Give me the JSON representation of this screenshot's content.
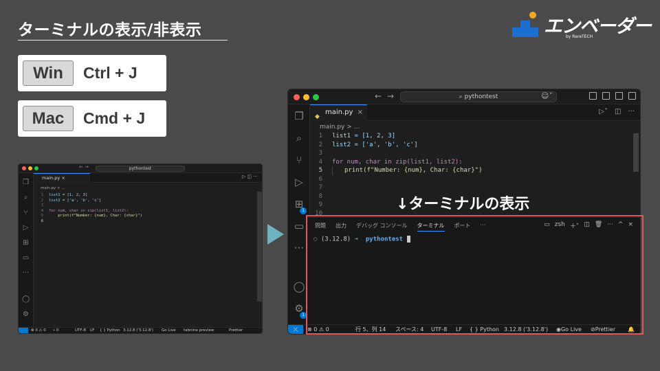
{
  "heading": "ターミナルの表示/非表示",
  "shortcuts": [
    {
      "os": "Win",
      "keys": "Ctrl + J"
    },
    {
      "os": "Mac",
      "keys": "Cmd + J"
    }
  ],
  "logo": {
    "word": "エンベーダー",
    "sub": "by RareTECH"
  },
  "caption": "↓ターミナルの表示",
  "colors": {
    "background": "#4a4a4a",
    "arrow": "#6fb3c2",
    "highlight": "#e0575a",
    "accent": "#0078d4"
  },
  "small_window": {
    "search": "pythontest",
    "tab": "main.py",
    "breadcrumb": "main.py > ...",
    "lines": [
      "1",
      "2",
      "3",
      "4",
      "5",
      "6"
    ],
    "code": [
      "list1 = [1, 2, 3]",
      "list2 = ['a', 'b', 'c']",
      "",
      "for num, char in zip(list1, list2):",
      "    print(f\"Number: {num}, Char: {char}\")",
      ""
    ],
    "status": {
      "problems": "⊗ 0 ⚠ 0",
      "ports": "⑂ 0",
      "encoding": "UTF-8",
      "eol": "LF",
      "language": "{ } Python",
      "interpreter": "3.12.8 ('3.12.8')",
      "golive": "Go Live",
      "tabnine": "tabnine preview",
      "prettier": "Prettier"
    }
  },
  "big_window": {
    "search": "pythontest",
    "tab": "main.py",
    "breadcrumb": "main.py > ...",
    "lines": [
      "1",
      "2",
      "3",
      "4",
      "5",
      "6",
      "7",
      "8",
      "9",
      "10"
    ],
    "code": {
      "l1": "list1 = [1, 2, 3]",
      "l2": "list2 = ['a', 'b', 'c']",
      "l4": "for num, char in zip(list1, list2):",
      "l5": "print(f\"Number: {num}, Char: {char}\")"
    },
    "panel_tabs": [
      "問題",
      "出力",
      "デバッグ コンソール",
      "ターミナル",
      "ポート",
      "···"
    ],
    "shell": "zsh",
    "terminal": {
      "env": "(3.12.8)",
      "arrow": "➜",
      "dir": "pythontest"
    },
    "status": {
      "problems": "⊗ 0 ⚠ 0",
      "position": "行 5、列 14",
      "spaces": "スペース: 4",
      "encoding": "UTF-8",
      "eol": "LF",
      "language": "{ } Python",
      "interpreter": "3.12.8 ('3.12.8')",
      "golive": "Go Live",
      "prettier": "Prettier"
    }
  }
}
